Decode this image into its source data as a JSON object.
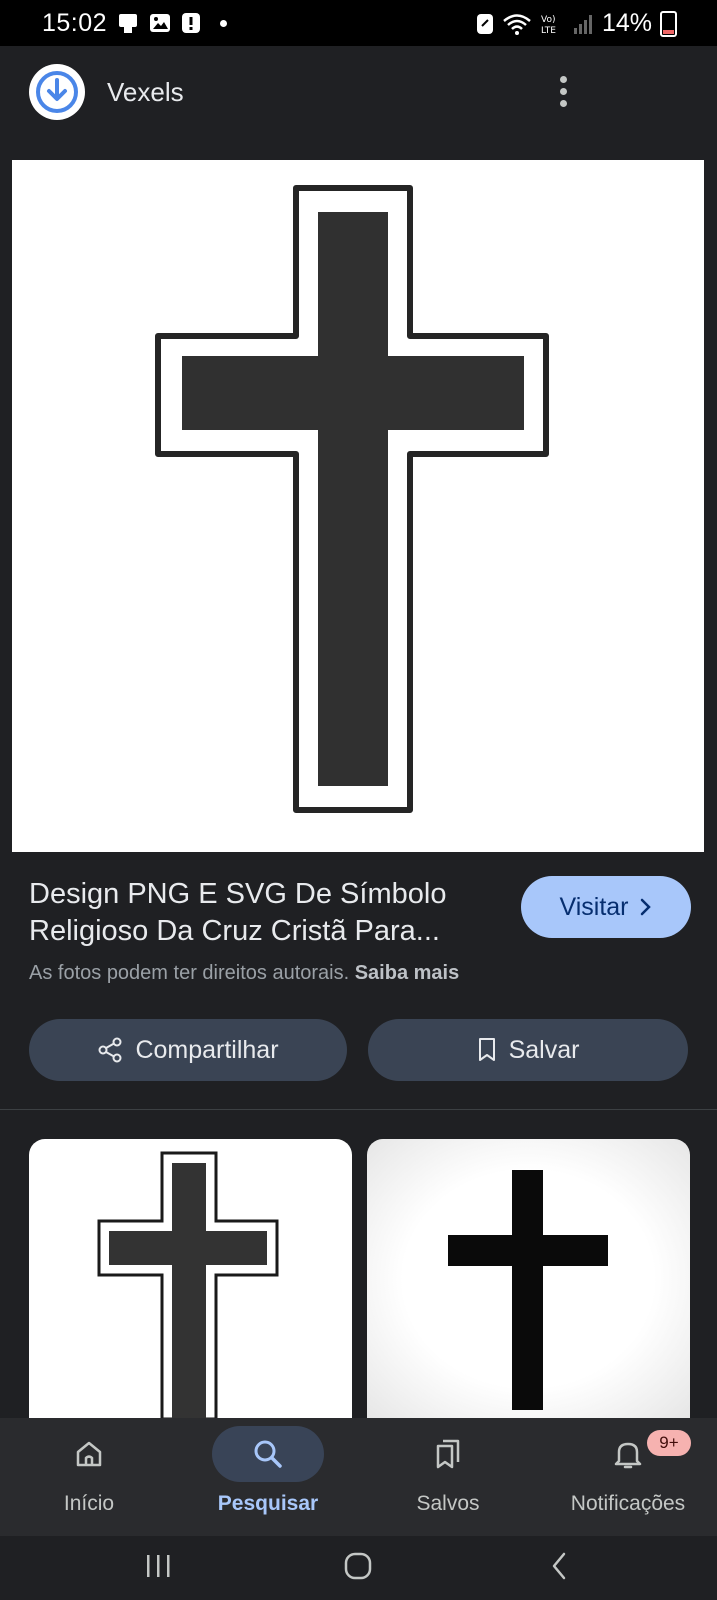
{
  "status_bar": {
    "time": "15:02",
    "battery_percent": "14%",
    "network_label": "Vo) LTE"
  },
  "header": {
    "site_name": "Vexels",
    "logo_icon": "vexels-logo-icon",
    "more_icon": "more-vert-icon"
  },
  "result": {
    "title": "Design PNG E SVG De Símbolo Religioso Da Cruz Cristã Para...",
    "visit_label": "Visitar",
    "copyright_text": "As fotos podem ter direitos autorais.",
    "learn_more": "Saiba mais",
    "share_label": "Compartilhar",
    "save_label": "Salvar"
  },
  "bottom_nav": {
    "items": [
      {
        "label": "Início",
        "icon": "home-icon"
      },
      {
        "label": "Pesquisar",
        "icon": "search-icon"
      },
      {
        "label": "Salvos",
        "icon": "bookmarks-icon"
      },
      {
        "label": "Notificações",
        "icon": "bell-icon",
        "badge": "9+"
      }
    ]
  },
  "colors": {
    "background": "#1f2023",
    "accent": "#a8c7fa",
    "button_bg": "#3a4454",
    "nav_bg": "#2a2b2e",
    "badge_bg": "#f6b2b0"
  }
}
